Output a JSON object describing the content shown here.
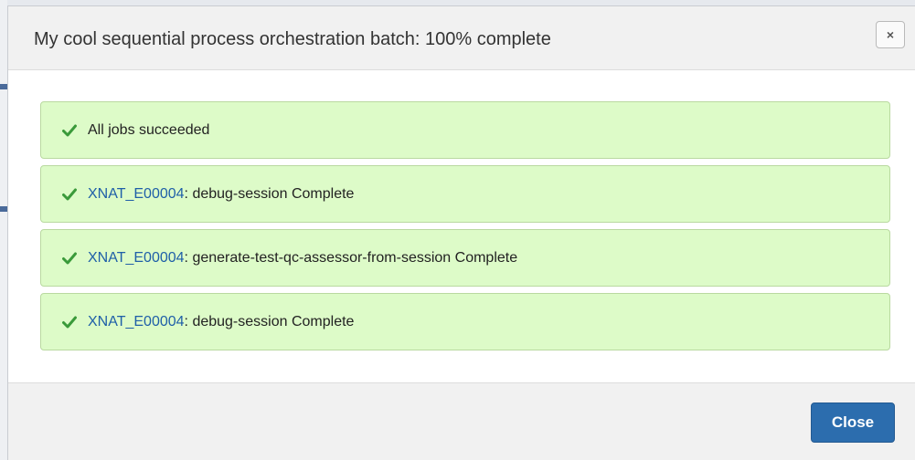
{
  "modal": {
    "title": "My cool sequential process orchestration batch: 100% complete",
    "close_x": "×",
    "close_button": "Close"
  },
  "status": {
    "summary": "All jobs succeeded",
    "jobs": [
      {
        "link": "XNAT_E00004",
        "text": ": debug-session Complete"
      },
      {
        "link": "XNAT_E00004",
        "text": ": generate-test-qc-assessor-from-session Complete"
      },
      {
        "link": "XNAT_E00004",
        "text": ": debug-session Complete"
      }
    ]
  },
  "colors": {
    "success_bg": "#ddfbc8",
    "success_check": "#3a9a3a",
    "link": "#1f5fa8",
    "primary_button": "#2c6dae"
  },
  "icons": {
    "status": "check-icon",
    "dismiss": "close-icon"
  }
}
